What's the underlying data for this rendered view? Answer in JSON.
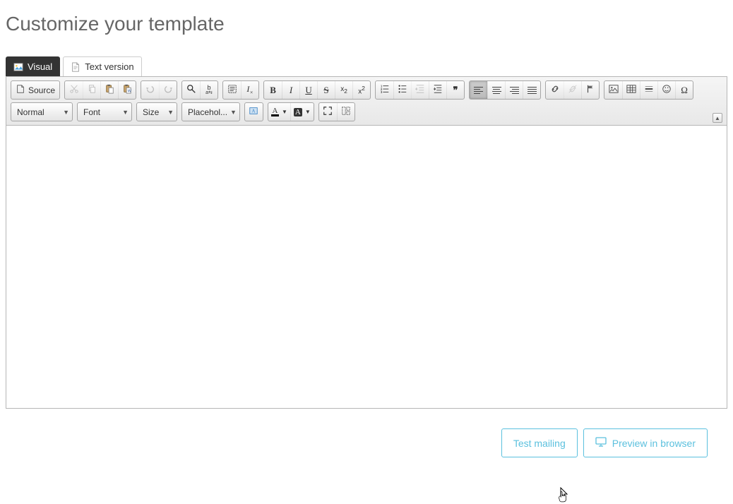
{
  "page": {
    "title": "Customize your template"
  },
  "tabs": {
    "visual": "Visual",
    "text_version": "Text version"
  },
  "toolbar": {
    "source": "Source",
    "format_combo": "Normal",
    "font_combo": "Font",
    "size_combo": "Size",
    "placeholder_combo": "Placehol...",
    "glyphs": {
      "bold": "B",
      "italic": "I",
      "underline": "U",
      "strike": "S",
      "sub": "x₂",
      "sup": "x²",
      "quote": "❝❝",
      "hr": "—",
      "omega": "Ω",
      "A": "A",
      "Tx": "Tₓ"
    }
  },
  "footer": {
    "test_mailing": "Test mailing",
    "preview": "Preview in browser"
  }
}
